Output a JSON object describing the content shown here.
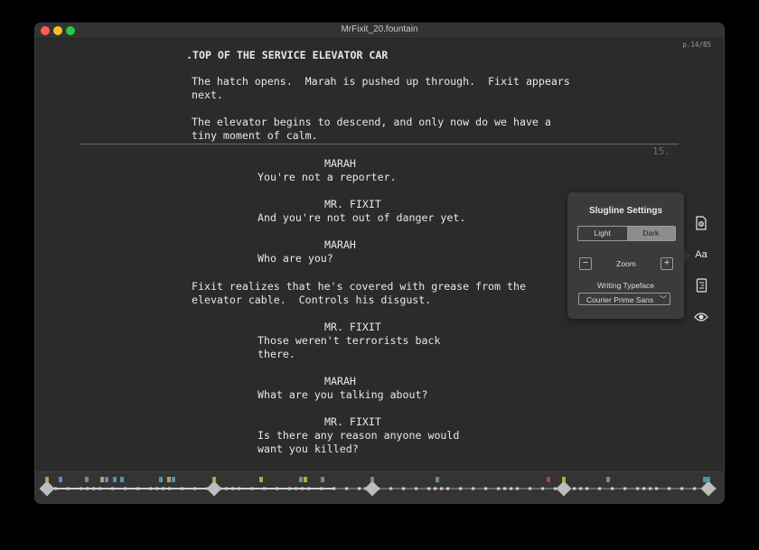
{
  "window": {
    "title": "MrFixit_20.fountain"
  },
  "page_indicator": "p.14/85",
  "script_lines": [
    {
      "kind": "scene",
      "text": ".TOP OF THE SERVICE ELEVATOR CAR"
    },
    {
      "kind": "action",
      "text": "The hatch opens.  Marah is pushed up through.  Fixit appears"
    },
    {
      "kind": "action",
      "text": "next."
    },
    {
      "kind": "action",
      "text": "The elevator begins to descend, and only now do we have a"
    },
    {
      "kind": "action",
      "text": "tiny moment of calm."
    },
    {
      "kind": "character",
      "text": "MARAH"
    },
    {
      "kind": "dialogue",
      "text": "You're not a reporter."
    },
    {
      "kind": "character",
      "text": "MR. FIXIT"
    },
    {
      "kind": "dialogue",
      "text": "And you're not out of danger yet."
    },
    {
      "kind": "character",
      "text": "MARAH"
    },
    {
      "kind": "dialogue",
      "text": "Who are you?"
    },
    {
      "kind": "action",
      "text": "Fixit realizes that he's covered with grease from the"
    },
    {
      "kind": "action",
      "text": "elevator cable.  Controls his disgust."
    },
    {
      "kind": "character",
      "text": "MR. FIXIT"
    },
    {
      "kind": "dialogue",
      "text": "Those weren't terrorists back"
    },
    {
      "kind": "dialogue",
      "text": "there."
    },
    {
      "kind": "character",
      "text": "MARAH"
    },
    {
      "kind": "dialogue",
      "text": "What are you talking about?"
    },
    {
      "kind": "character",
      "text": "MR. FIXIT"
    },
    {
      "kind": "dialogue",
      "text": "Is there any reason anyone would"
    },
    {
      "kind": "dialogue",
      "text": "want you killed?"
    }
  ],
  "page_number": "15.",
  "settings": {
    "title": "Slugline Settings",
    "theme_light": "Light",
    "theme_dark": "Dark",
    "theme_selected": "Dark",
    "zoom_minus": "−",
    "zoom_label": "Zoom",
    "zoom_plus": "+",
    "typeface_label": "Writing Typeface",
    "typeface_value": "Courier Prime Sans"
  },
  "tools": {
    "font_button": "Aa",
    "icons": [
      "document-settings-icon",
      "font-settings-icon",
      "outline-icon",
      "preview-eye-icon"
    ]
  },
  "colors": {
    "background": "#2b2b2b",
    "text": "#e8e8e8",
    "marker_blue": "#5a8fa8",
    "marker_yellow": "#b8a244",
    "marker_green": "#6f9a4a",
    "marker_red": "#b04040"
  }
}
